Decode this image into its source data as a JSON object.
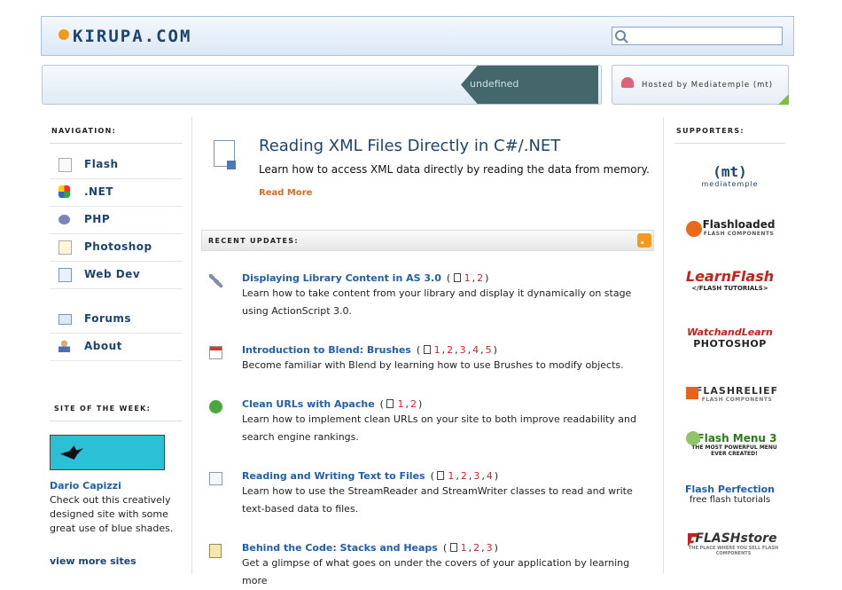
{
  "header": {
    "logo": "KIRUPA.COM",
    "search_placeholder": ""
  },
  "banner": {
    "tag": "undefined",
    "host_text": "Hosted by Mediatemple (mt)"
  },
  "nav": {
    "heading": "NAVIGATION:",
    "items": [
      {
        "label": "Flash",
        "icon": "page-icon"
      },
      {
        "label": ".NET",
        "icon": "dotnet-icon"
      },
      {
        "label": "PHP",
        "icon": "php-icon"
      },
      {
        "label": "Photoshop",
        "icon": "pencil-icon"
      },
      {
        "label": "Web Dev",
        "icon": "webdev-icon"
      }
    ],
    "items2": [
      {
        "label": "Forums",
        "icon": "forums-icon"
      },
      {
        "label": "About",
        "icon": "person-icon"
      }
    ]
  },
  "sotw": {
    "heading": "SITE OF THE WEEK:",
    "name": "Dario Capizzi",
    "desc": "Check out this creatively designed site with some great use of blue shades.",
    "view_more": "view more sites"
  },
  "feature": {
    "title": "Reading XML Files Directly in C#/.NET",
    "desc": "Learn how to access XML data directly by reading the data from memory.",
    "read_more": "Read More"
  },
  "updates": {
    "heading": "RECENT UPDATES:",
    "items": [
      {
        "title": "Displaying Library Content in AS 3.0",
        "pages": [
          "1",
          "2"
        ],
        "desc": "Learn how to take content from your library and display it dynamically on stage using ActionScript 3.0.",
        "icon": "wrench-icon"
      },
      {
        "title": "Introduction to Blend: Brushes",
        "pages": [
          "1",
          "2",
          "3",
          "4",
          "5"
        ],
        "desc": "Become familiar with Blend by learning how to use Brushes to modify objects.",
        "icon": "calendar-icon"
      },
      {
        "title": "Clean URLs with Apache",
        "pages": [
          "1",
          "2"
        ],
        "desc": "Learn how to implement clean URLs on your site to both improve readability and search engine rankings.",
        "icon": "checkmark-icon"
      },
      {
        "title": "Reading and Writing Text to Files",
        "pages": [
          "1",
          "2",
          "3",
          "4"
        ],
        "desc": "Learn how to use the StreamReader and StreamWriter classes to read and write text-based data to files.",
        "icon": "text-icon"
      },
      {
        "title": "Behind the Code: Stacks and Heaps",
        "pages": [
          "1",
          "2",
          "3"
        ],
        "desc": "Get a glimpse of what goes on under the covers of your application by learning more",
        "icon": "clipboard-icon"
      }
    ]
  },
  "supporters": {
    "heading": "SUPPORTERS:",
    "items": [
      {
        "line1": "(mt)",
        "line2": "mediatemple"
      },
      {
        "line1": "Flashloaded",
        "line2": "FLASH COMPONENTS"
      },
      {
        "line1": "LearnFlash",
        "line2": "</FLASH TUTORIALS>"
      },
      {
        "line1": "WatchandLearn",
        "line2": "PHOTOSHOP"
      },
      {
        "line1": "FLASHRELIEF",
        "line2": "FLASH COMPONENTS"
      },
      {
        "line1": "Flash Menu 3",
        "line2": "THE MOST POWERFUL MENU EVER CREATED!"
      },
      {
        "line1": "Flash Perfection",
        "line2": "free flash tutorials"
      },
      {
        "line1": "FLASHstore",
        "line2": "THE PLACE WHERE YOU SELL FLASH COMPONENTS"
      }
    ]
  }
}
